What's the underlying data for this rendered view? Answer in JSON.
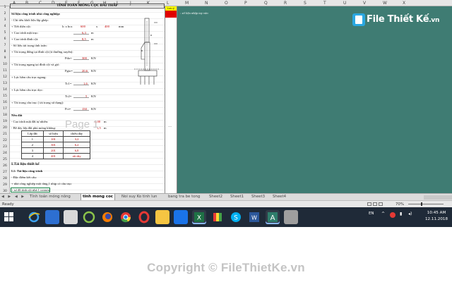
{
  "spreadsheet": {
    "columns": [
      "A",
      "B",
      "C",
      "D",
      "E",
      "F",
      "G",
      "H",
      "I",
      "J",
      "K",
      "L",
      "M",
      "N",
      "O",
      "P",
      "Q",
      "R",
      "S",
      "T",
      "U",
      "V",
      "W",
      "X"
    ],
    "rows": [
      "1",
      "2",
      "3",
      "4",
      "5",
      "6",
      "7",
      "8",
      "9",
      "10",
      "11",
      "12",
      "13",
      "14",
      "15",
      "16",
      "17",
      "18",
      "19",
      "20",
      "21",
      "22",
      "23",
      "24",
      "25",
      "26",
      "27",
      "28",
      "29",
      "30"
    ],
    "title": "TÍNH TOÁN MÓNG CỌC ĐÀI THẤP",
    "page_watermark": "Page 1",
    "col_header": "Lưu ý",
    "note_text": ": số liệu nhập tay vào",
    "ellipsis": "…",
    "lines": {
      "r2": "Số liệu công trình nhà công nghiệp:",
      "r3": "- Chỉ tiêu khối liệu lắp ghép:",
      "r4_label": "+ Tiết diện cột:",
      "r4_dims": "lc x bcx",
      "r4_v1": "600",
      "r4_x": "x",
      "r4_v2": "400",
      "r4_unit": "mm",
      "r5_label": "+ Cao trình mặt trục:",
      "r5_val": "6,3",
      "r5_unit": "m",
      "r6_label": "+ Cao trình đỉnh cột:",
      "r6_val": "8,5",
      "r6_unit": "m",
      "r7": "- Số liệu tải trọng tính toán:",
      "r8": "+ Tải trọng đứng tại đỉnh cột (tt thường xuyên):",
      "r9_label": "Pdo=",
      "r9_val": "300",
      "r9_unit": "KN",
      "r10": "+ Tải trọng ngang tại đỉnh cột và gió:",
      "r11_label": "Pgio=",
      "r11_val": "20,6",
      "r11_unit": "KN",
      "r12": "+ Lực hãm cầu trục ngang:",
      "r13_label": "Tc1=",
      "r13_val": "1,6",
      "r13_unit": "KN",
      "r14": "+ Lực hãm cầu trục dọc:",
      "r15_label": "Tc2=",
      "r15_val": "5",
      "r15_unit": "KN",
      "r16": "+ Tải trọng cầu trục ( tải trọng sử dụng):",
      "r17_label": "Pct=",
      "r17_val": "150",
      "r17_unit": "KN",
      "r18": "Nền đất",
      "r19_label": "- Cao trình mặt đất tự nhiên:",
      "r19_val": "0,00",
      "r19_unit": "m",
      "r20_label": "- Bề dày lớp đất phủ móng không:",
      "r20_val": "1,5",
      "r20_unit": "m",
      "r26": "I.Tài liệu thiết kế",
      "r27": "I.1: Tài liệu công trình",
      "r28": "- Đặc điểm kết cấu:",
      "r29": "+ nhà công nghiệp một tầng,1 nhịp có cầu trục",
      "r30": "+ sơ đồ tính cột nhà 1 consen"
    },
    "soil_table": {
      "headers": [
        "Lớp đất",
        "số hiệu",
        "chiều dày"
      ],
      "rows": [
        [
          "1",
          "101",
          "3,2"
        ],
        [
          "2",
          "301",
          "6,2"
        ],
        [
          "3",
          "201",
          "6,8"
        ],
        [
          "4",
          "401",
          "rất dày"
        ]
      ]
    }
  },
  "sheet_tabs": {
    "nav": "◀ ▶ ◀ ▶",
    "items": [
      "Tính toán móng nông",
      "tinh mong coc",
      "Noi suy Ko tinh lun",
      "bang tra be tong",
      "Sheet2",
      "Sheet1",
      "Sheet3",
      "Sheet4"
    ],
    "active_index": 1
  },
  "status": {
    "ready": "Ready",
    "zoom": "70%"
  },
  "taskbar": {
    "icons": [
      "start-icon",
      "ie-icon",
      "app-vnu-icon",
      "notepad-icon",
      "green-app-icon",
      "firefox-icon",
      "chrome-icon",
      "opera-icon",
      "file-explorer-icon",
      "blue-app-icon",
      "excel-icon",
      "rainbow-app-icon",
      "skype-icon",
      "word-icon",
      "autocad-icon",
      "gray-app-icon"
    ],
    "lang": "EN",
    "time": "10:45 AM",
    "date": "12.11.2018",
    "colors": {
      "taskbar_bg": "#1f2a38",
      "excel": "#1e7145",
      "skype": "#00aff0",
      "word": "#2b579a"
    }
  },
  "watermark": {
    "logo_text": "File Thiết Kế",
    "logo_suffix": ".vn",
    "copyright": "Copyright © FileThietKe.vn"
  },
  "colors": {
    "green_zone": "#3f7c73",
    "highlight_yellow": "#ffff00",
    "highlight_red": "#e00000",
    "value_red": "#c00000"
  }
}
